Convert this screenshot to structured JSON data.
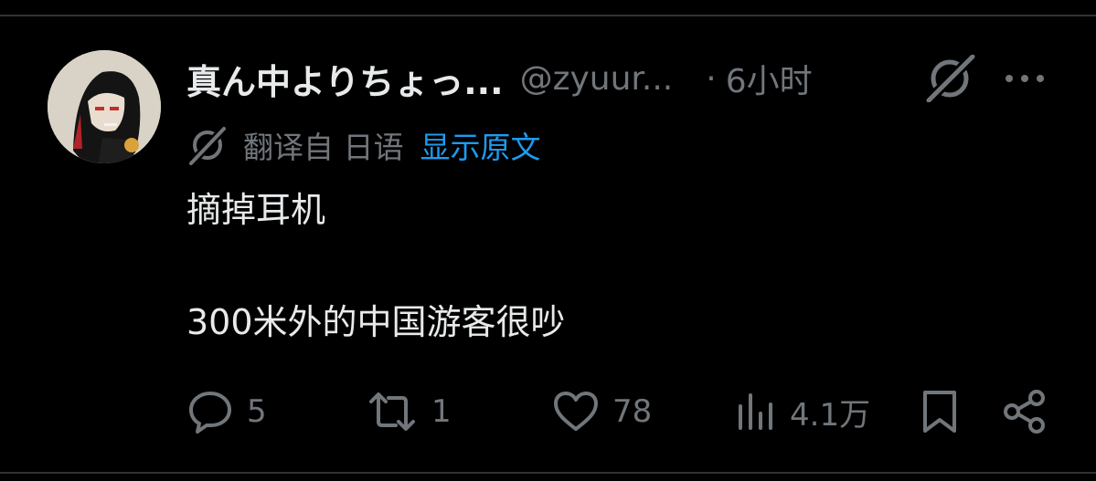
{
  "post": {
    "display_name": "真ん中よりちょっ...",
    "handle": "@zyuur...",
    "separator": "·",
    "time": "6小时",
    "translation_note": "翻译自 日语",
    "show_original_label": "显示原文",
    "text_lines": [
      "摘掉耳机",
      "",
      "300米外的中国游客很吵"
    ]
  },
  "actions": {
    "replies": "5",
    "reposts": "1",
    "likes": "78",
    "views": "4.1万"
  },
  "icons": {
    "grok": "grok-icon",
    "more": "more-icon",
    "translate": "translate-icon",
    "reply": "reply-icon",
    "repost": "repost-icon",
    "like": "heart-icon",
    "views": "views-icon",
    "bookmark": "bookmark-icon",
    "share": "share-icon"
  },
  "colors": {
    "background": "#000000",
    "text": "#e7e9ea",
    "muted": "#71767b",
    "link": "#1d9bf0",
    "divider": "#2f3336"
  }
}
